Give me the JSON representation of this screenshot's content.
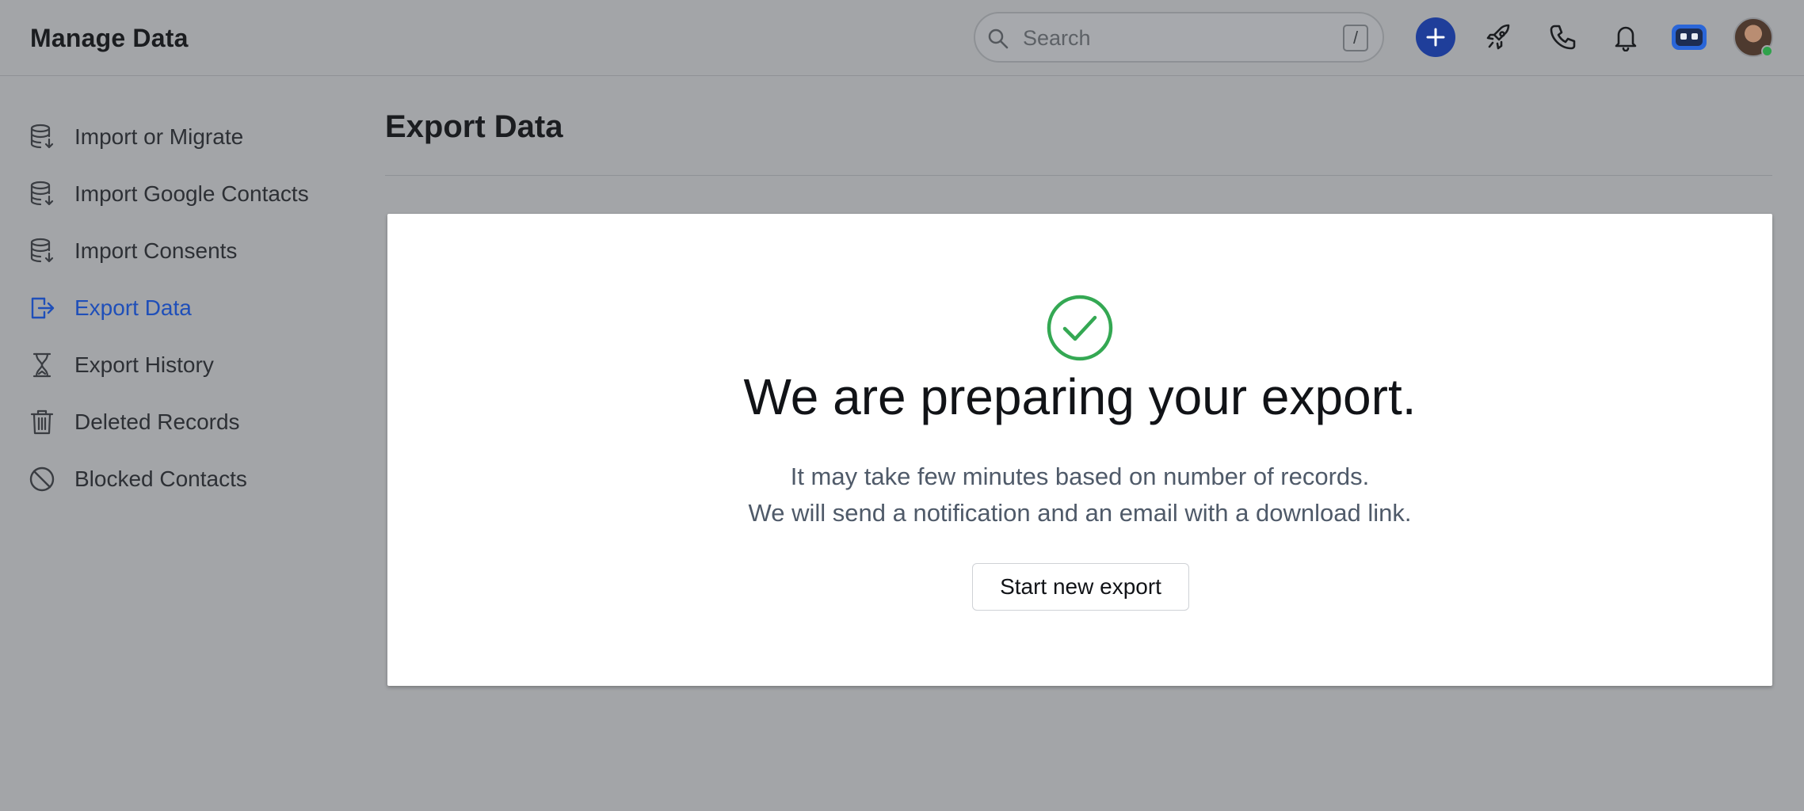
{
  "header": {
    "app_title": "Manage Data",
    "search": {
      "placeholder": "Search",
      "shortcut": "/"
    },
    "icons": [
      "search-icon",
      "plus-icon",
      "rocket-icon",
      "phone-icon",
      "bell-icon",
      "agent-icon"
    ]
  },
  "sidebar": {
    "items": [
      {
        "label": "Import or Migrate",
        "icon": "database-download-icon"
      },
      {
        "label": "Import Google Contacts",
        "icon": "database-download-icon"
      },
      {
        "label": "Import Consents",
        "icon": "database-download-icon"
      },
      {
        "label": "Export Data",
        "icon": "export-icon",
        "active": true
      },
      {
        "label": "Export History",
        "icon": "hourglass-icon"
      },
      {
        "label": "Deleted Records",
        "icon": "trash-icon"
      },
      {
        "label": "Blocked Contacts",
        "icon": "blocked-icon"
      }
    ]
  },
  "main": {
    "title": "Export Data",
    "card": {
      "heading": "We are preparing your export.",
      "line1": "It may take few minutes based on number of records.",
      "line2": "We will send a notification and an email with a download link.",
      "button": "Start new export"
    }
  },
  "colors": {
    "accent": "#1f4fb9",
    "success": "#34a853",
    "primary_button": "#1f3e9a",
    "background": "#a3a5a8"
  }
}
